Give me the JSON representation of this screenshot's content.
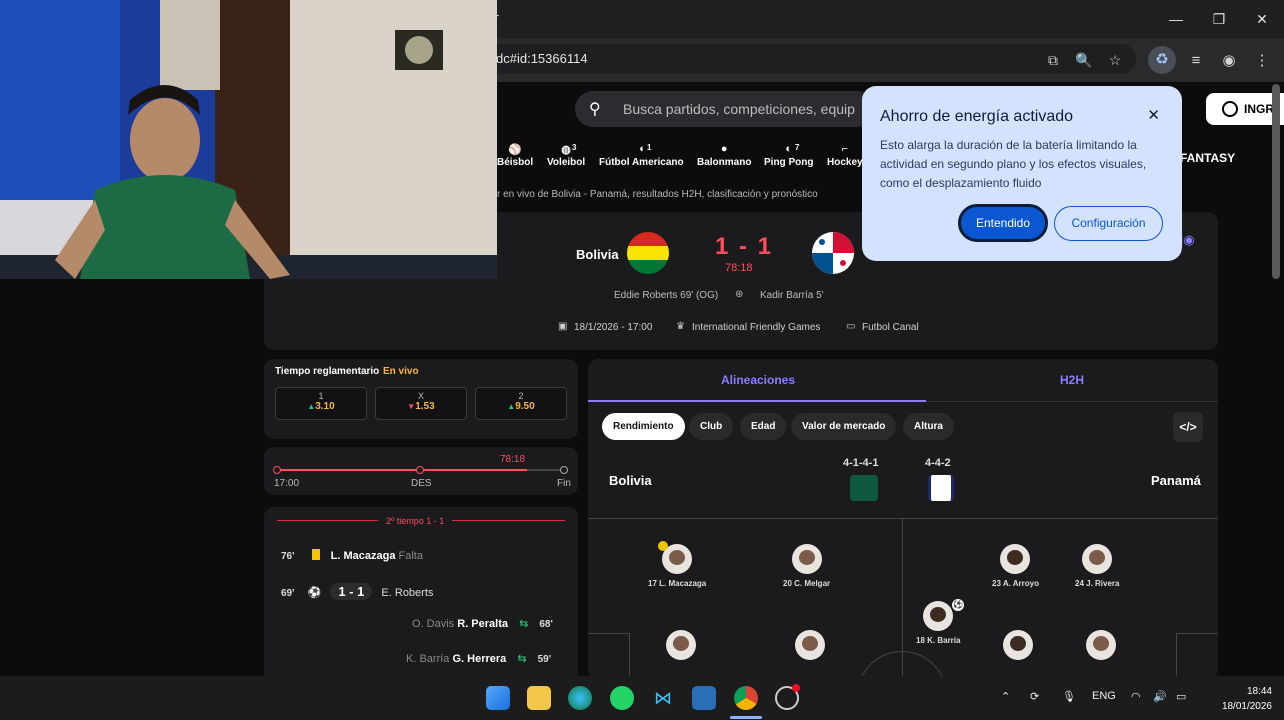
{
  "browser": {
    "url": "dc#id:15366114",
    "new_tab_glyph": "+",
    "window_controls": [
      "—",
      "❐",
      "✕"
    ]
  },
  "site": {
    "search_placeholder": "Busca partidos, competiciones, equip",
    "login_label": "INGR",
    "sports": [
      {
        "label": "Béisbol",
        "count": ""
      },
      {
        "label": "Voleibol",
        "count": "3"
      },
      {
        "label": "Fútbol Americano",
        "count": "1"
      },
      {
        "label": "Balonmano",
        "count": ""
      },
      {
        "label": "Ping Pong",
        "count": "7"
      },
      {
        "label": "Hockey",
        "count": ""
      }
    ],
    "fantasy_label": "FANTASY",
    "breadcrumb": "r en vivo de Bolivia - Panamá, resultados H2H, clasificación y pronóstico"
  },
  "match": {
    "home": "Bolivia",
    "away": "Panamá",
    "score": "1 - 1",
    "minute": "78:18",
    "home_scorer": "Eddie Roberts 69' (OG)",
    "away_scorer": "Kadir Barría 5'",
    "date": "18/1/2026 - 17:00",
    "competition": "International Friendly Games",
    "venue": "Futbol Canal"
  },
  "odds": {
    "title": "Tiempo reglamentario",
    "live": "En vivo",
    "items": [
      {
        "label": "1",
        "value": "3.10",
        "trend": "up"
      },
      {
        "label": "X",
        "value": "1.53",
        "trend": "down"
      },
      {
        "label": "2",
        "value": "9.50",
        "trend": "up"
      }
    ]
  },
  "timeline": {
    "current": "78:18",
    "start": "17:00",
    "mid": "DES",
    "end": "Fin",
    "progress": 0.87
  },
  "events": {
    "period": "2º tiempo 1 - 1",
    "rows": [
      {
        "minute": "76'",
        "player": "L. Macazaga",
        "detail": "Falta",
        "type": "yellow"
      },
      {
        "minute": "69'",
        "score": "1 - 1",
        "player": "E. Roberts",
        "type": "goal"
      },
      {
        "minute": "68'",
        "out": "O. Davis",
        "in": "R. Peralta",
        "type": "sub"
      },
      {
        "minute": "59'",
        "out": "K. Barría",
        "in": "G. Herrera",
        "type": "sub"
      }
    ]
  },
  "lineups": {
    "tabs": [
      "Alineaciones",
      "H2H"
    ],
    "chips": [
      "Rendimiento",
      "Club",
      "Edad",
      "Valor de mercado",
      "Altura"
    ],
    "home_team": "Bolivia",
    "away_team": "Panamá",
    "home_formation": "4-1-4-1",
    "away_formation": "4-4-2",
    "embed_icon": "</>",
    "players": [
      "17 L. Macazaga",
      "20 C. Melgar",
      "23 A. Arroyo",
      "24 J. Rivera",
      "18 K. Barría"
    ]
  },
  "popup": {
    "title": "Ahorro de energía activado",
    "body": "Esto alarga la duración de la batería limitando la actividad en segundo plano y los efectos visuales, como el desplazamiento fluido",
    "ok": "Entendido",
    "config": "Configuración",
    "close": "✕"
  },
  "taskbar": {
    "lang": "ENG",
    "time": "18:44",
    "date": "18/01/2026"
  },
  "colors": {
    "accent_red": "#ff4d5a",
    "odds_yellow": "#f5b841",
    "popup_bg": "#d3e3fd",
    "popup_primary": "#0b57d0",
    "lineup_tab": "#8a7dff"
  }
}
